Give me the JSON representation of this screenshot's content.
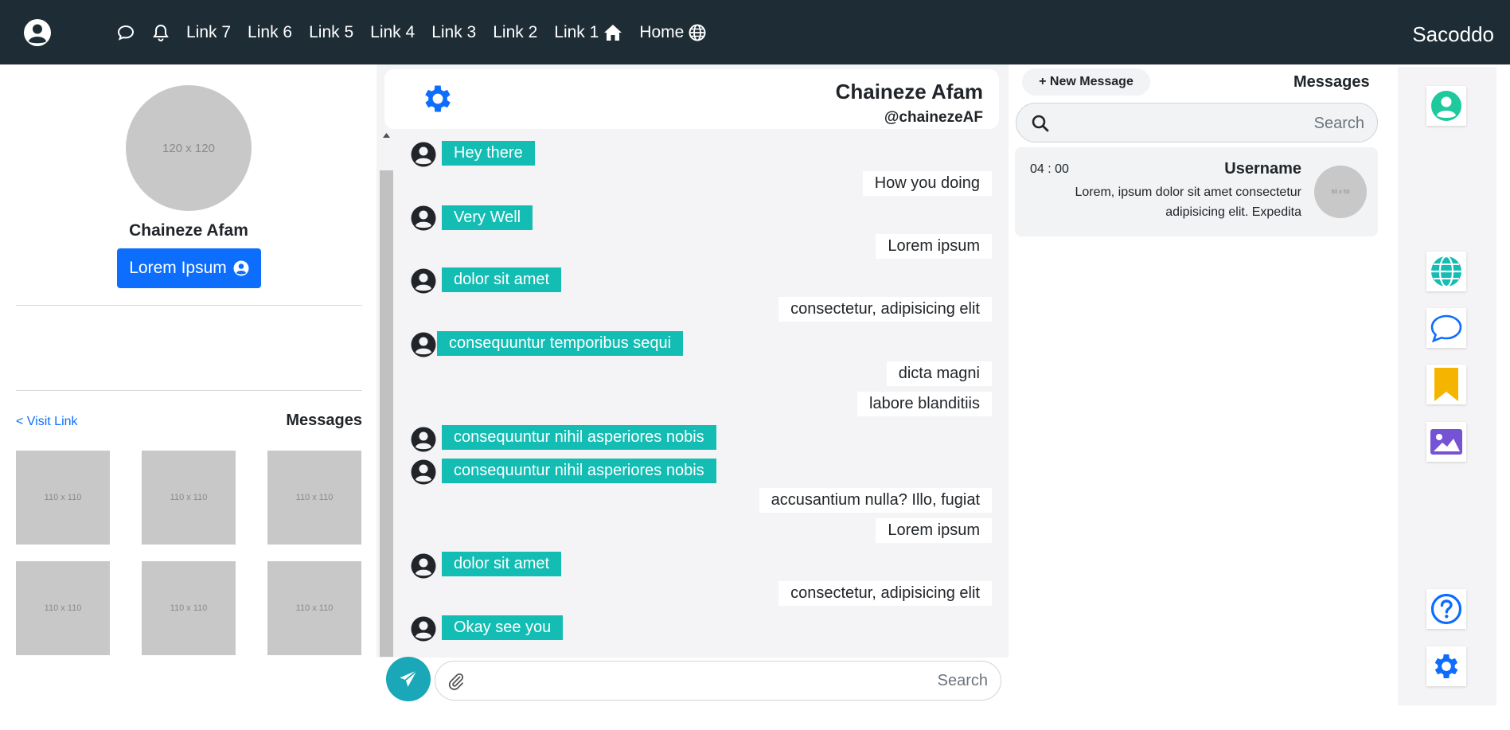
{
  "navbar": {
    "links": [
      "Link 7",
      "Link 6",
      "Link 5",
      "Link 4",
      "Link 3",
      "Link 2",
      "Link 1",
      "Home"
    ],
    "brand": "Sacoddo"
  },
  "profile": {
    "image_placeholder": "120 x 120",
    "name": "Chaineze Afam",
    "button_label": "Lorem Ipsum"
  },
  "left": {
    "visit_link": "< Visit Link",
    "messages_title": "Messages",
    "thumbs": [
      "110 x 110",
      "110 x 110",
      "110 x 110",
      "110 x 110",
      "110 x 110",
      "110 x 110"
    ]
  },
  "chat": {
    "name": "Chaineze Afam",
    "handle": "@chainezeAF",
    "messages": [
      {
        "dir": "in",
        "text": "Hey there"
      },
      {
        "dir": "out",
        "text": "How you doing"
      },
      {
        "dir": "in",
        "text": "Very Well"
      },
      {
        "dir": "out",
        "text": "Lorem ipsum"
      },
      {
        "dir": "in",
        "text": "dolor sit amet"
      },
      {
        "dir": "out",
        "text": "consectetur, adipisicing elit"
      },
      {
        "dir": "in",
        "text": "consequuntur temporibus sequi"
      },
      {
        "dir": "out",
        "text": "dicta magni"
      },
      {
        "dir": "out",
        "text": "labore blanditiis"
      },
      {
        "dir": "in",
        "text": "consequuntur nihil asperiores nobis"
      },
      {
        "dir": "in",
        "text": "consequuntur nihil asperiores nobis"
      },
      {
        "dir": "out",
        "text": "accusantium nulla? Illo, fugiat"
      },
      {
        "dir": "out",
        "text": "Lorem ipsum"
      },
      {
        "dir": "in",
        "text": "dolor sit amet"
      },
      {
        "dir": "out",
        "text": "consectetur, adipisicing elit"
      },
      {
        "dir": "in",
        "text": "Okay see you"
      }
    ],
    "input_placeholder": "Search"
  },
  "right": {
    "new_message": "+ New Message",
    "title": "Messages",
    "search_placeholder": "Search",
    "card": {
      "time": "04 : 00",
      "username": "Username",
      "text": "Lorem, ipsum dolor sit amet consectetur adipisicing elit. Expedita",
      "avatar_placeholder": "50 x 50"
    }
  },
  "sidebar": {
    "icons": [
      "user-icon",
      "globe-icon",
      "chat-icon",
      "bookmark-icon",
      "image-icon",
      "help-icon",
      "gear-icon"
    ]
  },
  "colors": {
    "navbar": "#1e2c36",
    "primary": "#0d6efd",
    "incoming_bubble": "#13bdb3",
    "send_button": "#1aa7b7",
    "user_icon": "#1ec99e",
    "bookmark": "#f5b400",
    "image_icon": "#7553d4"
  }
}
